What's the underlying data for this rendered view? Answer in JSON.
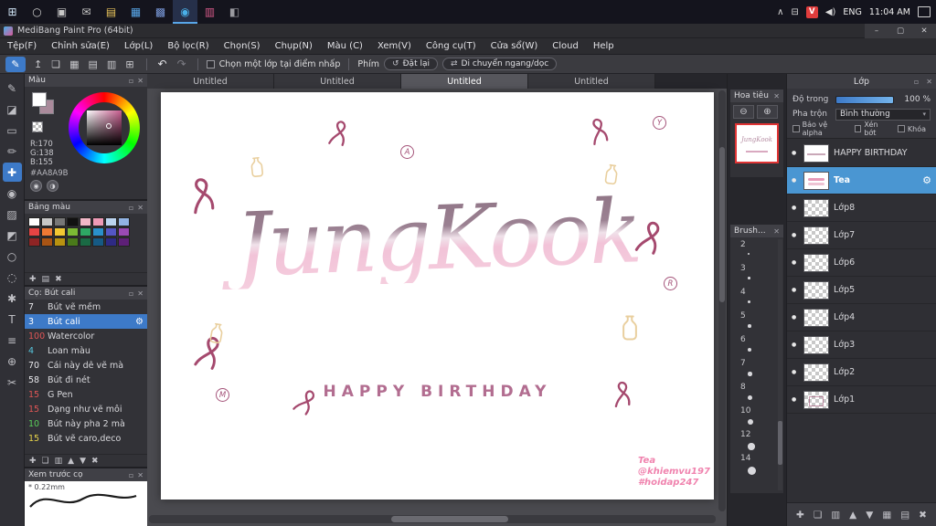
{
  "taskbar": {
    "left_icons": [
      {
        "name": "start-icon",
        "glyph": "⊞",
        "color": "#cfe3f5"
      },
      {
        "name": "search-icon",
        "glyph": "○",
        "color": "#c8c8c8"
      },
      {
        "name": "task-view-icon",
        "glyph": "▣",
        "color": "#c8c8c8"
      },
      {
        "name": "mail-icon",
        "glyph": "✉",
        "color": "#c8c8c8"
      },
      {
        "name": "file-explorer-icon",
        "glyph": "▤",
        "color": "#e8c35a"
      },
      {
        "name": "store-icon",
        "glyph": "▦",
        "color": "#58a6e8"
      },
      {
        "name": "photos-icon",
        "glyph": "▩",
        "color": "#7a9adb"
      },
      {
        "name": "medibang-icon",
        "glyph": "◉",
        "color": "#4ab0e8",
        "active": true
      },
      {
        "name": "palette-app-icon",
        "glyph": "▥",
        "color": "#d85a8a"
      },
      {
        "name": "settings-app-icon",
        "glyph": "◧",
        "color": "#9a9aa0"
      }
    ],
    "tray": {
      "chevron": "∧",
      "network": "⊟",
      "vlc": "V",
      "vlc_bg": "#e03c3c",
      "volume": "◀)",
      "lang": "ENG",
      "time": "11:04 AM"
    }
  },
  "window": {
    "title": "MediBang Paint Pro (64bit)",
    "minimize": "–",
    "maximize": "▢",
    "close": "✕"
  },
  "menus": [
    "Tệp(F)",
    "Chỉnh sửa(E)",
    "Lớp(L)",
    "Bộ lọc(R)",
    "Chọn(S)",
    "Chụp(N)",
    "Màu (C)",
    "Xem(V)",
    "Công cụ(T)",
    "Cửa sổ(W)",
    "Cloud",
    "Help"
  ],
  "toolbar": {
    "active_tool_glyph": "✎",
    "icons": [
      {
        "name": "save-upload-icon",
        "glyph": "↥"
      },
      {
        "name": "comment-icon",
        "glyph": "❏"
      },
      {
        "name": "grid-icon",
        "glyph": "▦"
      },
      {
        "name": "pages-icon",
        "glyph": "▤"
      },
      {
        "name": "panels-icon",
        "glyph": "▥"
      },
      {
        "name": "material-icon",
        "glyph": "⊞"
      }
    ],
    "undo": "↶",
    "redo": "↷",
    "select_layer_label": "Chọn một lớp tại điểm nhấp",
    "key_label": "Phím",
    "reset_icon": "↺",
    "reset_button": "Đặt lại",
    "move_icon": "⇄",
    "move_button": "Di chuyển ngang/dọc"
  },
  "tabs": [
    {
      "label": "Untitled"
    },
    {
      "label": "Untitled"
    },
    {
      "label": "Untitled",
      "active": true
    },
    {
      "label": "Untitled"
    }
  ],
  "tools": [
    {
      "name": "pen-tool",
      "glyph": "✎"
    },
    {
      "name": "eraser-tool",
      "glyph": "◪"
    },
    {
      "name": "select-tool",
      "glyph": "▭"
    },
    {
      "name": "brush-tool",
      "glyph": "✏"
    },
    {
      "name": "move-tool",
      "glyph": "✚",
      "active": true
    },
    {
      "name": "eyedropper-tool",
      "glyph": "◉"
    },
    {
      "name": "fill-tool",
      "glyph": "▨"
    },
    {
      "name": "gradient-tool",
      "glyph": "◩"
    },
    {
      "name": "shape-tool",
      "glyph": "○"
    },
    {
      "name": "lasso-tool",
      "glyph": "◌"
    },
    {
      "name": "wand-tool",
      "glyph": "✱"
    },
    {
      "name": "text-tool",
      "glyph": "T"
    },
    {
      "name": "pan-tool",
      "glyph": "≡"
    },
    {
      "name": "zoom-tool",
      "glyph": "⊕"
    },
    {
      "name": "divide-tool",
      "glyph": "✂"
    }
  ],
  "color_panel": {
    "title": "Màu",
    "r": "R:170",
    "g": "G:138",
    "b": "B:155",
    "hex": "#AA8A9B",
    "current_color": "#AA8A9B"
  },
  "palette_panel": {
    "title": "Bảng màu",
    "swatches": [
      "#ffffff",
      "#c8c8c8",
      "#777777",
      "#111111",
      "#f2b8c8",
      "#ee9ab6",
      "#bcd4f0",
      "#92b4e4",
      "#e64444",
      "#ee7a34",
      "#f2c832",
      "#7cba34",
      "#2ea864",
      "#2a90ca",
      "#5456c4",
      "#9a4ab4",
      "#8e2424",
      "#a85414",
      "#b89210",
      "#4a7a1a",
      "#1a6a44",
      "#165a84",
      "#2e2a84",
      "#5e2078"
    ],
    "footer_icons": [
      {
        "name": "add-color-icon",
        "glyph": "✚"
      },
      {
        "name": "palette-menu-icon",
        "glyph": "▤"
      },
      {
        "name": "delete-color-icon",
        "glyph": "✖"
      }
    ]
  },
  "brush_panel": {
    "title": "Cọ: Bút cali",
    "brushes": [
      {
        "size": "7",
        "name": "Bút vẽ mềm",
        "num_color": "#e8e8ec"
      },
      {
        "size": "3",
        "name": "Bút cali",
        "num_color": "#ffffff",
        "selected": true
      },
      {
        "size": "100",
        "name": "Watercolor",
        "num_color": "#e05656"
      },
      {
        "size": "4",
        "name": "Loan màu",
        "num_color": "#56c8e0"
      },
      {
        "size": "70",
        "name": "Cái này dễ vẽ mà",
        "num_color": "#e8e8ec"
      },
      {
        "size": "58",
        "name": "Bút đi nét",
        "num_color": "#e8e8ec"
      },
      {
        "size": "15",
        "name": "G Pen",
        "num_color": "#e05656"
      },
      {
        "size": "15",
        "name": "Dạng như vẽ môi",
        "num_color": "#e05656"
      },
      {
        "size": "10",
        "name": "Bút này pha 2 mà",
        "num_color": "#5ad05a"
      },
      {
        "size": "15",
        "name": "Bút vẽ caro,deco",
        "num_color": "#e8d44a"
      }
    ],
    "footer_icons": [
      {
        "name": "add-brush-icon",
        "glyph": "✚"
      },
      {
        "name": "duplicate-brush-icon",
        "glyph": "❏"
      },
      {
        "name": "brush-folder-icon",
        "glyph": "▥"
      },
      {
        "name": "brush-up-icon",
        "glyph": "▲"
      },
      {
        "name": "brush-down-icon",
        "glyph": "▼"
      },
      {
        "name": "delete-brush-icon",
        "glyph": "✖"
      }
    ]
  },
  "preview_panel": {
    "title": "Xem trước cọ",
    "size_label": "* 0.22mm"
  },
  "navigator": {
    "title": "Hoa tiêu",
    "zoom_out_icon": "⊖",
    "zoom_in_icon": "⊕"
  },
  "brush_sizes": {
    "title": "Brush...",
    "items": [
      {
        "label": "2",
        "dot": 2
      },
      {
        "label": "3",
        "dot": 2.5
      },
      {
        "label": "4",
        "dot": 3
      },
      {
        "label": "5",
        "dot": 3.5
      },
      {
        "label": "6",
        "dot": 4
      },
      {
        "label": "7",
        "dot": 4.5
      },
      {
        "label": "8",
        "dot": 5
      },
      {
        "label": "10",
        "dot": 6
      },
      {
        "label": "12",
        "dot": 7.5
      },
      {
        "label": "14",
        "dot": 9
      }
    ]
  },
  "layers_panel": {
    "title": "Lớp",
    "opacity_label": "Độ trong",
    "opacity_value": "100 %",
    "blend_label": "Pha trộn",
    "blend_value": "Bình thường",
    "alpha_protect_label": "Bảo vệ alpha",
    "clipping_label": "Xén bớt",
    "lock_label": "Khóa",
    "layers": [
      {
        "name": "HAPPY BIRTHDAY",
        "thumb": "white-text"
      },
      {
        "name": "Tea",
        "thumb": "white-logo",
        "selected": true
      },
      {
        "name": "Lớp8",
        "thumb": "checker"
      },
      {
        "name": "Lớp7",
        "thumb": "checker"
      },
      {
        "name": "Lớp6",
        "thumb": "checker"
      },
      {
        "name": "Lớp5",
        "thumb": "checker"
      },
      {
        "name": "Lớp4",
        "thumb": "checker"
      },
      {
        "name": "Lớp3",
        "thumb": "checker"
      },
      {
        "name": "Lớp2",
        "thumb": "checker"
      },
      {
        "name": "Lớp1",
        "thumb": "checker-art"
      }
    ],
    "footer_icons": [
      {
        "name": "new-layer-icon",
        "glyph": "✚"
      },
      {
        "name": "duplicate-layer-icon",
        "glyph": "❏"
      },
      {
        "name": "layer-folder-icon",
        "glyph": "▥"
      },
      {
        "name": "layer-up-icon",
        "glyph": "▲"
      },
      {
        "name": "layer-down-icon",
        "glyph": "▼"
      },
      {
        "name": "merge-layer-icon",
        "glyph": "▦"
      },
      {
        "name": "layer-menu-icon",
        "glyph": "▤"
      },
      {
        "name": "delete-layer-icon",
        "glyph": "✖"
      }
    ]
  },
  "icons": {
    "close": "✕",
    "undock": "▫",
    "eye": "●",
    "gear": "⚙",
    "caret_down": "▾"
  },
  "colors": {
    "accent_blue": "#3d7ac8",
    "selection_blue": "#4a96d2"
  },
  "canvas": {
    "title_text": "JungKook",
    "subtitle": "HAPPY BIRTHDAY",
    "signature_line1": "Tea",
    "signature_line2": "@khiemvu197",
    "signature_line3": "#hoidap247",
    "badges": [
      "A",
      "Y",
      "R",
      "M"
    ],
    "doodle_color": "#a5496e",
    "accent_doodle_color": "#e9cf9e"
  }
}
